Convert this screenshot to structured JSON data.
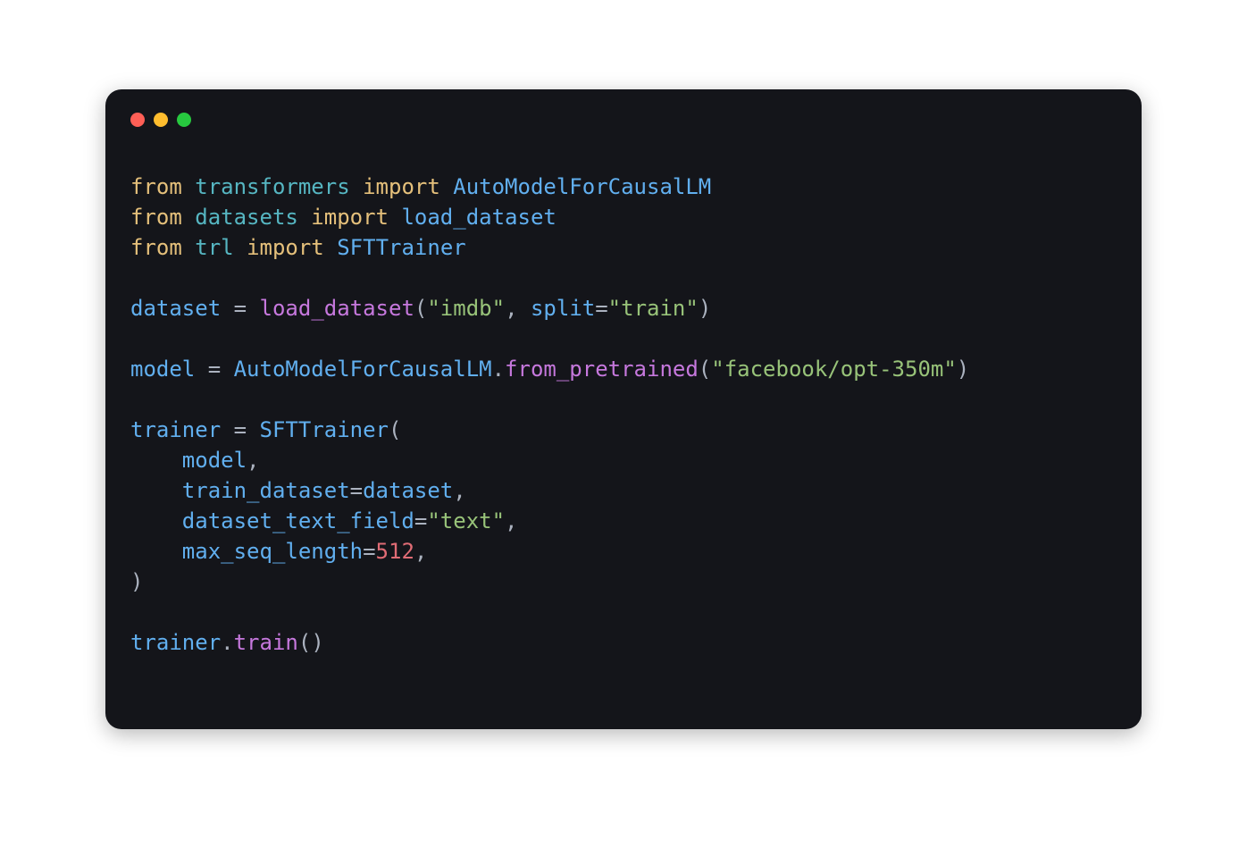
{
  "window": {
    "dot_colors": {
      "red": "#ff5f56",
      "yellow": "#ffbd2e",
      "green": "#27c93f"
    }
  },
  "code": {
    "kw_from": "from",
    "kw_import": "import",
    "mod_transformers": "transformers",
    "cls_AutoModel": "AutoModelForCausalLM",
    "mod_datasets": "datasets",
    "fn_load_dataset": "load_dataset",
    "mod_trl": "trl",
    "cls_SFTTrainer": "SFTTrainer",
    "var_dataset": "dataset",
    "str_imdb": "\"imdb\"",
    "kwarg_split": "split",
    "str_train": "\"train\"",
    "var_model": "model",
    "fn_from_pretrained": "from_pretrained",
    "str_fb_opt": "\"facebook/opt-350m\"",
    "var_trainer": "trainer",
    "arg_model": "model",
    "kwarg_train_dataset": "train_dataset",
    "arg_dataset": "dataset",
    "kwarg_dataset_text_field": "dataset_text_field",
    "str_text": "\"text\"",
    "kwarg_max_seq_length": "max_seq_length",
    "num_512": "512",
    "fn_train": "train",
    "indent": "    ",
    "eq": " = ",
    "eq_tight": "=",
    "lparen": "(",
    "rparen": ")",
    "dot": ".",
    "comma": ","
  }
}
